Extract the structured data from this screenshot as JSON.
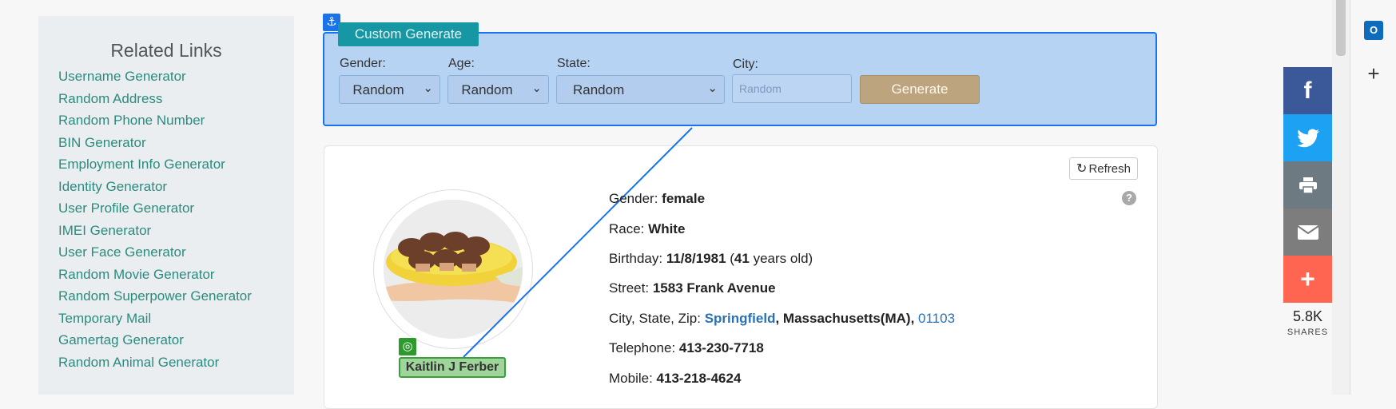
{
  "sidebar": {
    "title": "Related Links",
    "links": [
      "Username Generator",
      "Random Address",
      "Random Phone Number",
      "BIN Generator",
      "Employment Info Generator",
      "Identity Generator",
      "User Profile Generator",
      "IMEI Generator",
      "User Face Generator",
      "Random Movie Generator",
      "Random Superpower Generator",
      "Temporary Mail",
      "Gamertag Generator",
      "Random Animal Generator"
    ]
  },
  "generator": {
    "title": "Custom Generate",
    "gender_label": "Gender:",
    "gender_value": "Random",
    "age_label": "Age:",
    "age_value": "Random",
    "state_label": "State:",
    "state_value": "Random",
    "city_label": "City:",
    "city_placeholder": "Random",
    "generate_label": "Generate"
  },
  "profile": {
    "refresh_label": "Refresh",
    "name": "Kaitlin J Ferber",
    "gender_label": "Gender:",
    "gender": "female",
    "race_label": "Race:",
    "race": "White",
    "birthday_label": "Birthday:",
    "birthday": "11/8/1981",
    "age": "41",
    "age_suffix": "years old)",
    "street_label": "Street:",
    "street": "1583 Frank Avenue",
    "city_label": "City, State, Zip:",
    "city": "Springfield",
    "state": ", Massachusetts(MA),",
    "zip": "01103",
    "telephone_label": "Telephone:",
    "telephone": "413-230-7718",
    "mobile_label": "Mobile:",
    "mobile": "413-218-4624"
  },
  "share": {
    "count": "5.8K",
    "label": "SHARES",
    "colors": {
      "facebook": "#3b5998",
      "twitter": "#1da1f2",
      "print": "#6e7a82",
      "email": "#7d7d7d",
      "more": "#ff6550"
    }
  },
  "colors": {
    "link": "#2a8b7e",
    "panel_bg": "#b6d3f4",
    "panel_border": "#1a73e8",
    "zip_link": "#2a72b5"
  }
}
